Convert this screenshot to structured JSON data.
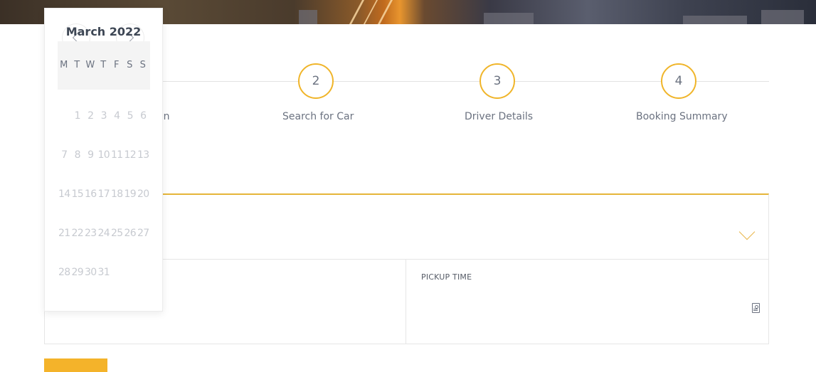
{
  "steps": [
    {
      "number": "2",
      "label": "Search for Car"
    },
    {
      "number": "3",
      "label": "Driver Details"
    },
    {
      "number": "4",
      "label": "Booking Summary"
    }
  ],
  "step1_label_partial": "on",
  "form": {
    "pickup_time_label": "PICKUP TIME"
  },
  "datepicker": {
    "title": "March 2022",
    "weekdays": [
      "M",
      "T",
      "W",
      "T",
      "F",
      "S",
      "S"
    ],
    "weeks": [
      [
        "",
        "1",
        "2",
        "3",
        "4",
        "5",
        "6"
      ],
      [
        "7",
        "8",
        "9",
        "10",
        "11",
        "12",
        "13"
      ],
      [
        "14",
        "15",
        "16",
        "17",
        "18",
        "19",
        "20"
      ],
      [
        "21",
        "22",
        "23",
        "24",
        "25",
        "26",
        "27"
      ],
      [
        "28",
        "29",
        "30",
        "31",
        "",
        "",
        ""
      ]
    ]
  },
  "icons": {
    "prev": "chevron-left-icon",
    "next": "chevron-right-icon",
    "dropdown": "chevron-down-icon",
    "time": "clock-icon"
  },
  "colors": {
    "accent": "#f0b52a",
    "button": "#f4b32a",
    "text": "#6b7280",
    "day_text": "#c7cad0"
  }
}
